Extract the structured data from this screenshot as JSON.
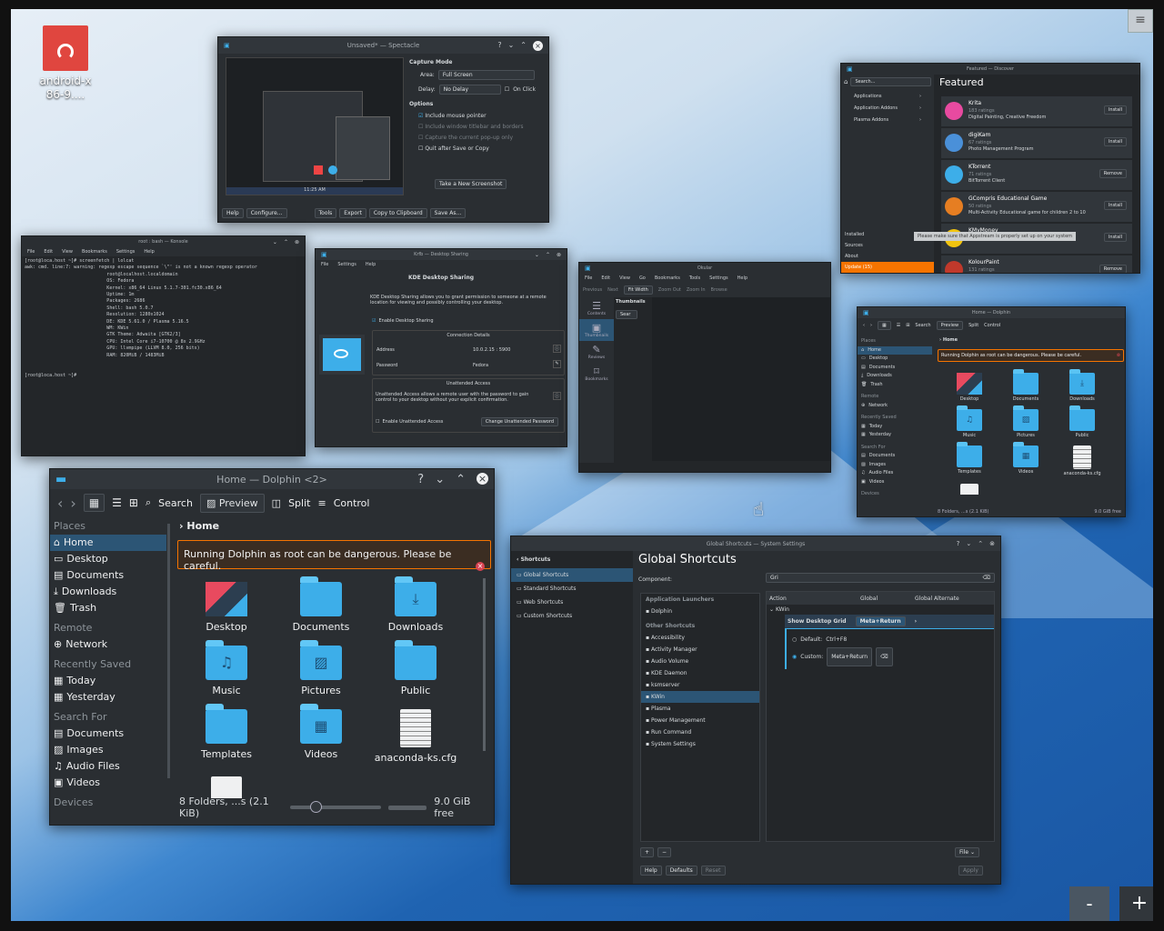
{
  "desktop": {
    "icon_label": "android-x86-9....",
    "zoom_out": "-",
    "zoom_in": "+"
  },
  "spectacle": {
    "title": "Unsaved* — Spectacle",
    "capture_mode": "Capture Mode",
    "area_label": "Area:",
    "area_value": "Full Screen",
    "delay_label": "Delay:",
    "delay_value": "No Delay",
    "on_click": "On Click",
    "options": "Options",
    "opt1": "Include mouse pointer",
    "opt2": "Include window titlebar and borders",
    "opt3": "Capture the current pop-up only",
    "opt4": "Quit after Save or Copy",
    "new_shot": "Take a New Screenshot",
    "help": "Help",
    "configure": "Configure...",
    "tools": "Tools",
    "export": "Export",
    "copy": "Copy to Clipboard",
    "saveas": "Save As...",
    "clock": "11:25 AM"
  },
  "discover": {
    "title": "Featured — Discover",
    "search": "Search...",
    "featured": "Featured",
    "nav": [
      "Applications",
      "Application Addons",
      "Plasma Addons"
    ],
    "bottom": [
      "Installed",
      "Sources",
      "About",
      "Update (15)"
    ],
    "tooltip": "Please make sure that Appstream is properly set up on your system",
    "apps": [
      {
        "name": "Krita",
        "ratings": "183 ratings",
        "desc": "Digital Painting, Creative Freedom",
        "btn": "Install"
      },
      {
        "name": "digiKam",
        "ratings": "67 ratings",
        "desc": "Photo Management Program",
        "btn": "Install"
      },
      {
        "name": "KTorrent",
        "ratings": "71 ratings",
        "desc": "BitTorrent Client",
        "btn": "Remove"
      },
      {
        "name": "GCompris Educational Game",
        "ratings": "50 ratings",
        "desc": "Multi-Activity Educational game for children 2 to 10",
        "btn": "Install"
      },
      {
        "name": "KMyMoney",
        "ratings": "",
        "desc": "",
        "btn": "Install"
      },
      {
        "name": "KolourPaint",
        "ratings": "131 ratings",
        "desc": "",
        "btn": "Remove"
      }
    ]
  },
  "konsole": {
    "title": "root : bash — Konsole",
    "menu": [
      "File",
      "Edit",
      "View",
      "Bookmarks",
      "Settings",
      "Help"
    ],
    "lines": [
      "[root@loca.host ~]# screenfetch | lolcat",
      "awk: cmd. line:7: warning: regexp escape sequence `\\\"' is not a known regexp operator",
      "                              root@localhost.localdomain",
      "                              OS: Fedora",
      "                              Kernel: x86_64 Linux 5.1.7-301.fc30.x86_64",
      "                              Uptime: 1m",
      "                              Packages: 2686",
      "                              Shell: bash 5.0.7",
      "                              Resolution: 1280x1024",
      "                              DE: KDE 5.61.0 / Plasma 5.16.5",
      "                              WM: KWin",
      "                              GTK Theme: Adwaita [GTK2/3]",
      "                              CPU: Intel Core i7-10700 @ 8x 2.9GHz",
      "                              GPU: llvmpipe (LLVM 8.0, 256 bits)",
      "                              RAM: 820MiB / 1483MiB",
      "",
      "",
      "[root@loca.host ~]# "
    ]
  },
  "krfb": {
    "title": "Krfb — Desktop Sharing",
    "menu": [
      "File",
      "Settings",
      "Help"
    ],
    "heading": "KDE Desktop Sharing",
    "desc": "KDE Desktop Sharing allows you to grant permission to someone at a remote location for viewing and possibly controlling your desktop.",
    "enable": "Enable Desktop Sharing",
    "conn": "Connection Details",
    "address_label": "Address",
    "address": "10.0.2.15 : 5900",
    "password_label": "Password",
    "password": "Fedora",
    "unattended": "Unattended Access",
    "unattended_desc": "Unattended Access allows a remote user with the password to gain control to your desktop without your explicit confirmation.",
    "enable_unattended": "Enable Unattended Access",
    "change_pw": "Change Unattended Password"
  },
  "okular": {
    "title": "Okular",
    "menu": [
      "File",
      "Edit",
      "View",
      "Go",
      "Bookmarks",
      "Tools",
      "Settings",
      "Help"
    ],
    "previous": "Previous",
    "next": "Next",
    "fit": "Fit Width",
    "zoom_out": "Zoom Out",
    "zoom_in": "Zoom In",
    "browse": "Browse",
    "thumbnails": "Thumbnails",
    "search": "Sear",
    "side": [
      "Contents",
      "Thumbnails",
      "Reviews",
      "Bookmarks"
    ]
  },
  "dolphin_small": {
    "title": "Home — Dolphin",
    "search": "Search",
    "preview": "Preview",
    "split": "Split",
    "control": "Control",
    "places": "Places",
    "items": [
      "Home",
      "Desktop",
      "Documents",
      "Downloads",
      "Trash"
    ],
    "remote": "Remote",
    "network": "Network",
    "recent": "Recently Saved",
    "today": "Today",
    "yesterday": "Yesterday",
    "searchfor": "Search For",
    "sitems": [
      "Documents",
      "Images",
      "Audio Files",
      "Videos"
    ],
    "devices": "Devices",
    "crumb": "Home",
    "warning": "Running Dolphin as root can be dangerous. Please be careful.",
    "files": [
      "Desktop",
      "Documents",
      "Downloads",
      "Music",
      "Pictures",
      "Public",
      "Templates",
      "Videos",
      "anaconda-ks.cfg"
    ],
    "status": "8 Folders, ...s (2.1 KiB)",
    "free": "9.0 GiB free"
  },
  "dolphin": {
    "title": "Home — Dolphin <2>",
    "search": "Search",
    "preview": "Preview",
    "split": "Split",
    "control": "Control",
    "places": "Places",
    "items": [
      "Home",
      "Desktop",
      "Documents",
      "Downloads",
      "Trash"
    ],
    "remote": "Remote",
    "network": "Network",
    "recent": "Recently Saved",
    "today": "Today",
    "yesterday": "Yesterday",
    "searchfor": "Search For",
    "sitems": [
      "Documents",
      "Images",
      "Audio Files",
      "Videos"
    ],
    "devices": "Devices",
    "crumb": "Home",
    "warning": "Running Dolphin as root can be dangerous. Please be careful.",
    "files": [
      "Desktop",
      "Documents",
      "Downloads",
      "Music",
      "Pictures",
      "Public",
      "Templates",
      "Videos",
      "anaconda-ks.cfg"
    ],
    "status": "8 Folders, ...s (2.1 KiB)",
    "free": "9.0 GiB free"
  },
  "shortcuts": {
    "title": "Global Shortcuts — System Settings",
    "back": "Shortcuts",
    "nav": [
      "Global Shortcuts",
      "Standard Shortcuts",
      "Web Shortcuts",
      "Custom Shortcuts"
    ],
    "heading": "Global Shortcuts",
    "component": "Component:",
    "filter": "Gri",
    "launchers": "Application Launchers",
    "launch_items": [
      "Dolphin"
    ],
    "other": "Other Shortcuts",
    "other_items": [
      "Accessibility",
      "Activity Manager",
      "Audio Volume",
      "KDE Daemon",
      "ksmserver",
      "KWin",
      "Plasma",
      "Power Management",
      "Run Command",
      "System Settings"
    ],
    "col_action": "Action",
    "col_global": "Global",
    "col_alt": "Global Alternate",
    "group": "KWin",
    "action": "Show Desktop Grid",
    "action_key": "Meta+Return",
    "default_label": "Default:",
    "default_key": "Ctrl+F8",
    "custom_label": "Custom:",
    "custom_key": "Meta+Return",
    "file": "File",
    "help": "Help",
    "defaults": "Defaults",
    "reset": "Reset",
    "apply": "Apply"
  }
}
